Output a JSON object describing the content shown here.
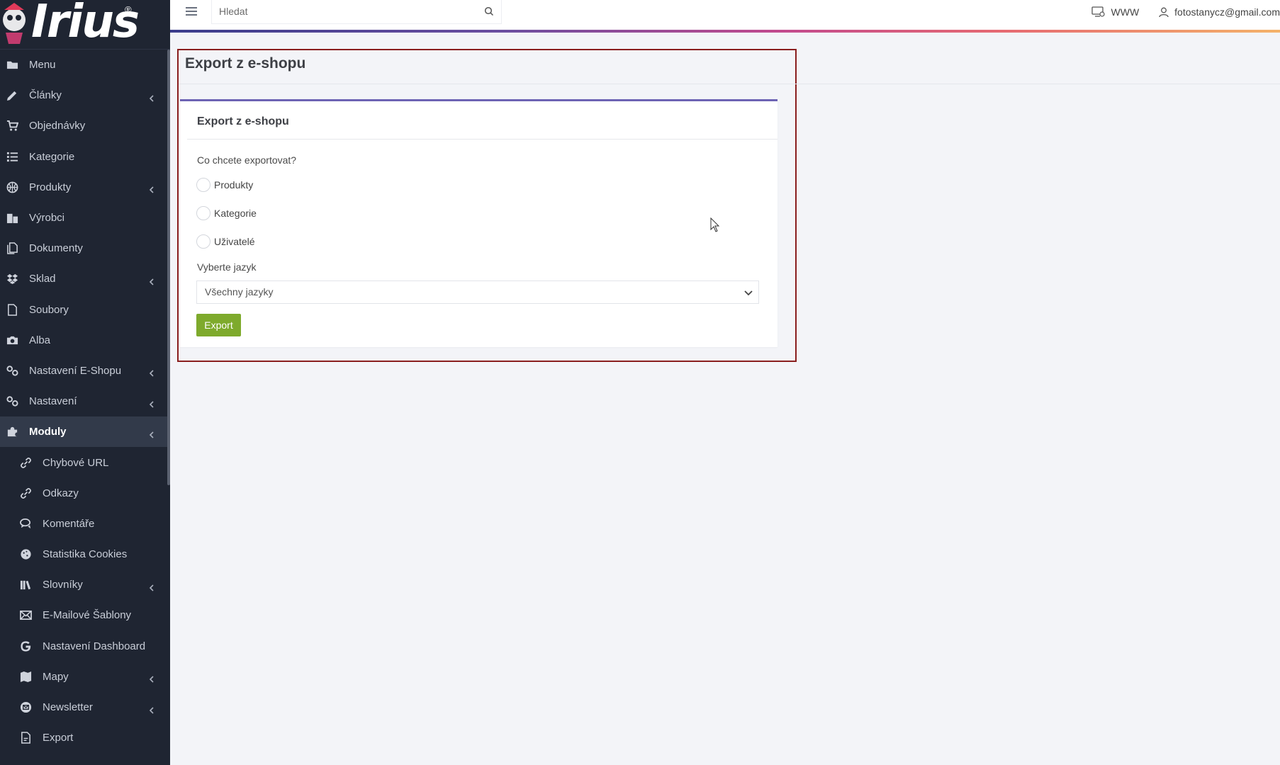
{
  "logo": {
    "text": "Irius",
    "reg": "®"
  },
  "topbar": {
    "search_placeholder": "Hledat",
    "www_label": "WWW",
    "user_email": "fotostanycz@gmail.com"
  },
  "sidebar": {
    "items": [
      {
        "label": "Menu",
        "icon": "folder-icon",
        "chevron": false
      },
      {
        "label": "Články",
        "icon": "pencil-icon",
        "chevron": true
      },
      {
        "label": "Objednávky",
        "icon": "cart-icon",
        "chevron": false
      },
      {
        "label": "Kategorie",
        "icon": "list-icon",
        "chevron": false
      },
      {
        "label": "Produkty",
        "icon": "basketball-icon",
        "chevron": true
      },
      {
        "label": "Výrobci",
        "icon": "building-icon",
        "chevron": false
      },
      {
        "label": "Dokumenty",
        "icon": "documents-icon",
        "chevron": false
      },
      {
        "label": "Sklad",
        "icon": "dropbox-icon",
        "chevron": true
      },
      {
        "label": "Soubory",
        "icon": "file-icon",
        "chevron": false
      },
      {
        "label": "Alba",
        "icon": "camera-icon",
        "chevron": false
      },
      {
        "label": "Nastavení E-Shopu",
        "icon": "cogs-icon",
        "chevron": true
      },
      {
        "label": "Nastavení",
        "icon": "cogs-icon",
        "chevron": true
      },
      {
        "label": "Moduly",
        "icon": "puzzle-icon",
        "chevron": true,
        "active": true
      },
      {
        "label": "Chybové URL",
        "icon": "link-icon",
        "chevron": false,
        "sub": true
      },
      {
        "label": "Odkazy",
        "icon": "link-icon",
        "chevron": false,
        "sub": true
      },
      {
        "label": "Komentáře",
        "icon": "comments-icon",
        "chevron": false,
        "sub": true
      },
      {
        "label": "Statistika Cookies",
        "icon": "cookie-icon",
        "chevron": false,
        "sub": true
      },
      {
        "label": "Slovníky",
        "icon": "books-icon",
        "chevron": true,
        "sub": true
      },
      {
        "label": "E-Mailové Šablony",
        "icon": "envelope-icon",
        "chevron": false,
        "sub": true
      },
      {
        "label": "Nastavení Dashboard",
        "icon": "google-icon",
        "chevron": false,
        "sub": true
      },
      {
        "label": "Mapy",
        "icon": "map-icon",
        "chevron": true,
        "sub": true
      },
      {
        "label": "Newsletter",
        "icon": "mail-circle-icon",
        "chevron": true,
        "sub": true
      },
      {
        "label": "Export",
        "icon": "export-file-icon",
        "chevron": false,
        "sub": true
      }
    ]
  },
  "main": {
    "page_title": "Export z e-shopu",
    "card_title": "Export z e-shopu",
    "question": "Co chcete exportovat?",
    "options": [
      "Produkty",
      "Kategorie",
      "Uživatelé"
    ],
    "language_label": "Vyberte jazyk",
    "language_value": "Všechny jazyky",
    "export_button": "Export"
  },
  "colors": {
    "sidebar_bg": "#1f2532",
    "accent_purple": "#6d63b4",
    "export_green": "#7eaa2c",
    "highlight_border": "#8a1e1e"
  }
}
